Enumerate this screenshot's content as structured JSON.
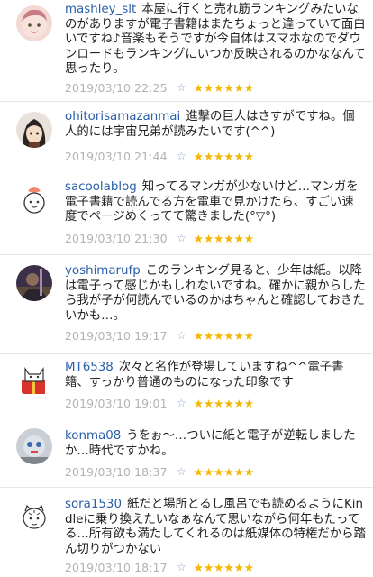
{
  "comments": [
    {
      "username": "mashley_slt",
      "text": "本屋に行くと売れ筋ランキングみたいなのがありますが電子書籍はまたちょっと違っていて面白いですね♪音楽もそうですが今自体はスマホなのでダウンロードもランキングにいつか反映されるのかななんて思ったり。",
      "timestamp": "2019/03/10 22:25",
      "rating": "★★★★★★",
      "avatar": "illustrated-face-avatar"
    },
    {
      "username": "ohitorisamazanmai",
      "text": "進撃の巨人はさすがですね。個人的には宇宙兄弟が読みたいです(^^)",
      "timestamp": "2019/03/10 21:44",
      "rating": "★★★★★★",
      "avatar": "anime-girl-avatar"
    },
    {
      "username": "sacoolablog",
      "text": "知ってるマンガが少ないけど…マンガを電子書籍で読んでる方を電車で見かけたら、すごい速度でページめくってて驚きました(°▽°)",
      "timestamp": "2019/03/10 21:30",
      "rating": "★★★★★★",
      "avatar": "cartoon-character-avatar"
    },
    {
      "username": "yoshimarufp",
      "text": "このランキング見ると、少年は紙。以降は電子って感じかもしれないですね。確かに親からしたら我が子が何読んでいるのかはちゃんと確認しておきたいかも…。",
      "timestamp": "2019/03/10 19:17",
      "rating": "★★★★★★",
      "avatar": "photo-avatar"
    },
    {
      "username": "MT6538",
      "text": "次々と名作が登場していますね^^電子書籍、すっかり普通のものになった印象です",
      "timestamp": "2019/03/10 19:01",
      "rating": "★★★★★★",
      "avatar": "cat-gift-avatar"
    },
    {
      "username": "konma08",
      "text": "うをぉ〜…ついに紙と電子が逆転しましたか…時代ですかね。",
      "timestamp": "2019/03/10 18:37",
      "rating": "★★★★★★",
      "avatar": "toy-figure-avatar"
    },
    {
      "username": "sora1530",
      "text": "紙だと場所とるし風呂でも読めるようにKindleに乗り換えたいなぁなんて思いながら何年もたってる…所有欲も満たしてくれるのは紙媒体の特権だから踏ん切りがつかない",
      "timestamp": "2019/03/10 18:17",
      "rating": "★★★★★★",
      "avatar": "tiger-sketch-avatar"
    }
  ],
  "colors": {
    "username": "#2a5fa8",
    "timestamp": "#b3b3b3",
    "star": "#f2b705",
    "star_outline": "#8fa9d8"
  }
}
